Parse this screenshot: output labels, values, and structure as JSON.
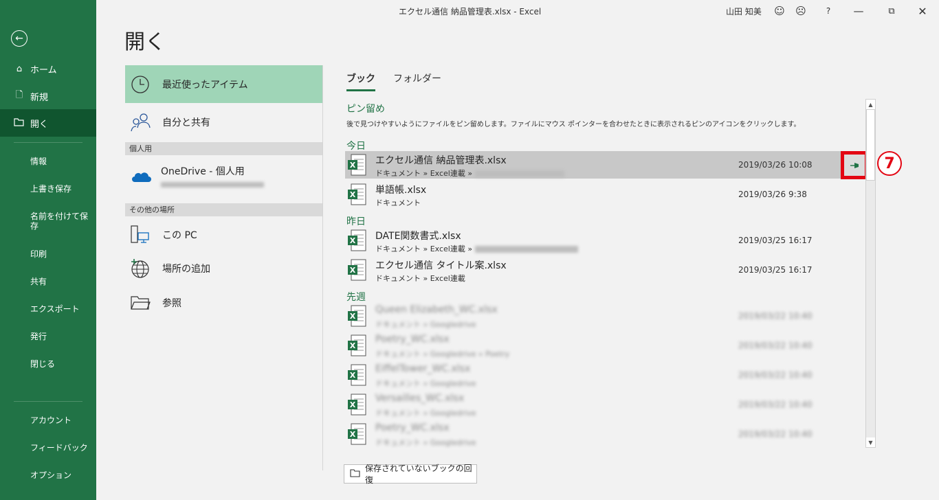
{
  "window": {
    "title": "エクセル通信 納品管理表.xlsx  -  Excel",
    "user": "山田 知美",
    "help": "?"
  },
  "nav": {
    "items": [
      {
        "label": "ホーム"
      },
      {
        "label": "新規"
      },
      {
        "label": "開く"
      }
    ],
    "sub": [
      "情報",
      "上書き保存",
      "名前を付けて保存",
      "印刷",
      "共有",
      "エクスポート",
      "発行",
      "閉じる"
    ],
    "bottom": [
      "アカウント",
      "フィードバック",
      "オプション"
    ]
  },
  "page": {
    "title": "開く"
  },
  "places": {
    "recent": "最近使ったアイテム",
    "shared": "自分と共有",
    "section_personal": "個人用",
    "onedrive": "OneDrive - 個人用",
    "section_other": "その他の場所",
    "this_pc": "この PC",
    "add_place": "場所の追加",
    "browse": "参照"
  },
  "tabs": {
    "book": "ブック",
    "folder": "フォルダー"
  },
  "pinned": {
    "heading": "ピン留め",
    "description": "後で見つけやすいようにファイルをピン留めします。ファイルにマウス ポインターを合わせたときに表示されるピンのアイコンをクリックします。"
  },
  "groups": {
    "today": "今日",
    "yesterday": "昨日",
    "last_week": "先週"
  },
  "files": [
    {
      "name": "エクセル通信 納品管理表.xlsx",
      "path": "ドキュメント » Excel連載 »",
      "date": "2019/03/26 10:08"
    },
    {
      "name": "単語帳.xlsx",
      "path": "ドキュメント",
      "date": "2019/03/26 9:38"
    },
    {
      "name": "DATE関数書式.xlsx",
      "path": "ドキュメント » Excel連載 »",
      "date": "2019/03/25 16:17"
    },
    {
      "name": "エクセル通信 タイトル案.xlsx",
      "path": "ドキュメント » Excel連載",
      "date": "2019/03/25 16:17"
    },
    {
      "name": "Queen Elizabeth_WC.xlsx",
      "path": "ドキュメント » Googledrive",
      "date": "2019/03/22 10:40"
    },
    {
      "name": "Poetry_WC.xlsx",
      "path": "ドキュメント » Googledrive » Poetry",
      "date": "2019/03/22 10:40"
    },
    {
      "name": "EiffelTower_WC.xlsx",
      "path": "ドキュメント » Googledrive",
      "date": "2019/03/22 10:40"
    },
    {
      "name": "Versailles_WC.xlsx",
      "path": "ドキュメント » Googledrive",
      "date": "2019/03/22 10:40"
    },
    {
      "name": "Poetry_WC.xlsx",
      "path": "ドキュメント » Googledrive",
      "date": "2019/03/22 10:40"
    }
  ],
  "annotation": {
    "step": "7"
  },
  "recover_button": "保存されていないブックの回復",
  "colors": {
    "accent": "#217346",
    "highlight": "#e30613"
  }
}
